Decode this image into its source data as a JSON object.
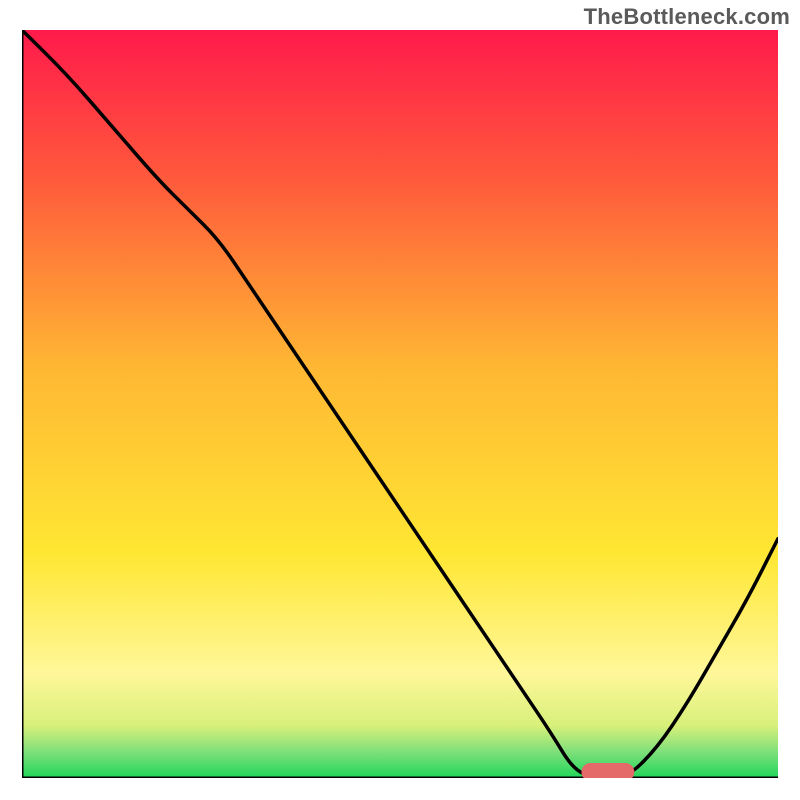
{
  "watermark": "TheBottleneck.com",
  "chart_data": {
    "type": "line",
    "title": "",
    "xlabel": "",
    "ylabel": "",
    "xlim": [
      0,
      100
    ],
    "ylim": [
      0,
      100
    ],
    "grid": false,
    "legend": false,
    "background_gradient": {
      "stops": [
        {
          "offset": 0.0,
          "color": "#ff1a4b"
        },
        {
          "offset": 0.2,
          "color": "#ff5a3c"
        },
        {
          "offset": 0.45,
          "color": "#ffb733"
        },
        {
          "offset": 0.7,
          "color": "#ffe733"
        },
        {
          "offset": 0.86,
          "color": "#fff79a"
        },
        {
          "offset": 0.93,
          "color": "#d8f07a"
        },
        {
          "offset": 0.965,
          "color": "#7fe07a"
        },
        {
          "offset": 1.0,
          "color": "#1fd65a"
        }
      ]
    },
    "series": [
      {
        "name": "bottleneck-curve",
        "color": "#000000",
        "x": [
          0,
          6,
          12,
          18,
          22,
          26,
          30,
          36,
          42,
          48,
          54,
          60,
          66,
          70,
          73,
          76,
          80,
          84,
          88,
          92,
          96,
          100
        ],
        "y": [
          100,
          94,
          87,
          80,
          76,
          72,
          66,
          57,
          48,
          39,
          30,
          21,
          12,
          6,
          1,
          0,
          0,
          4,
          10,
          17,
          24,
          32
        ]
      }
    ],
    "marker": {
      "name": "optimal-range",
      "color": "#e46a6a",
      "x_start": 74,
      "x_end": 81,
      "y": 0.8,
      "thickness": 2.4
    }
  }
}
